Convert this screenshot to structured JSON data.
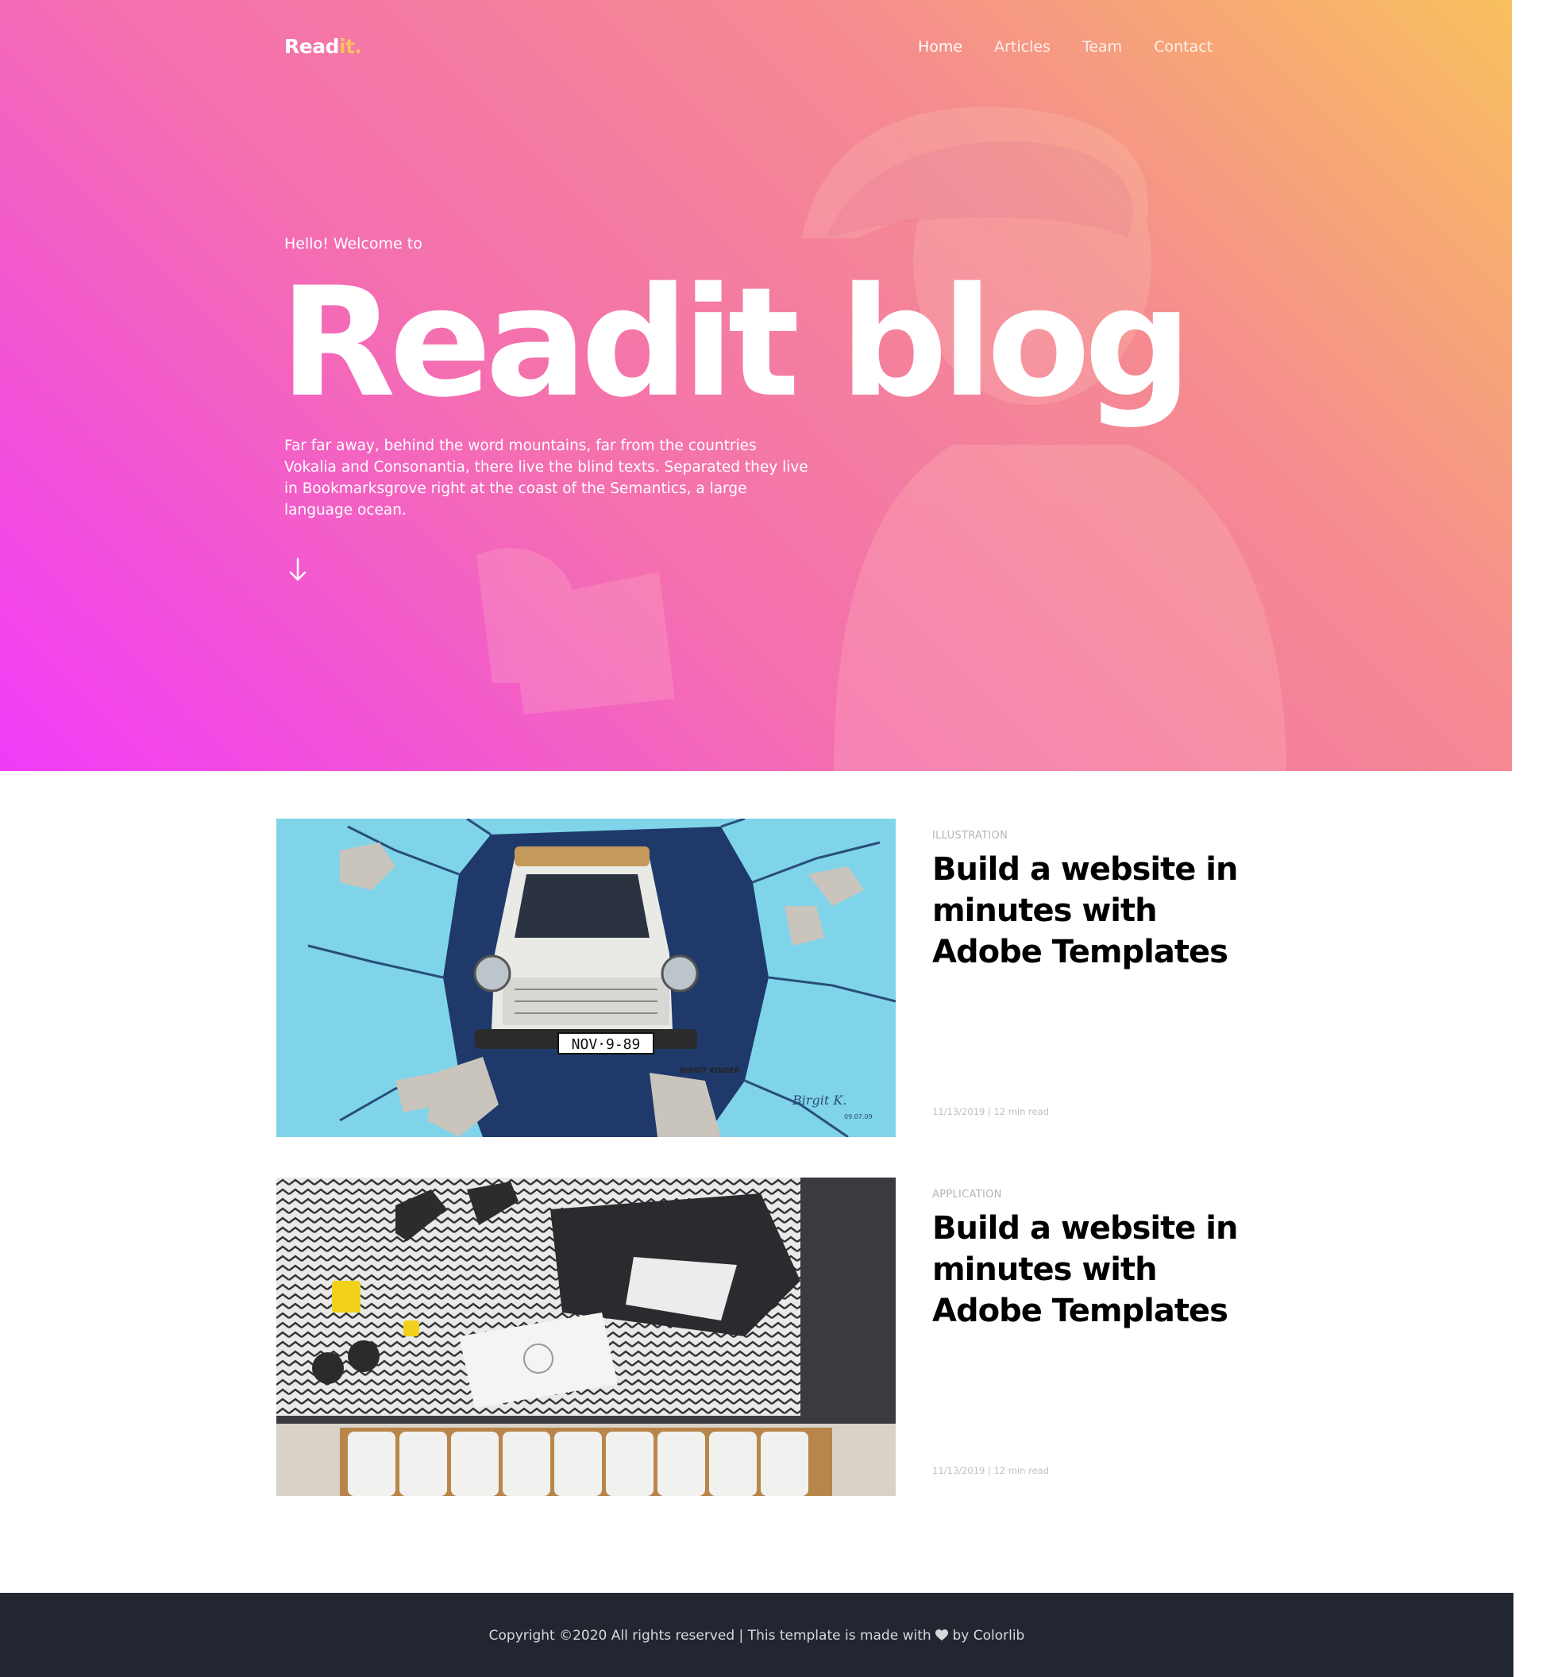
{
  "brand": {
    "name_main": "Read",
    "name_accent": "it",
    "name_dot": ".",
    "accent_color": "#f9c05e"
  },
  "nav": {
    "items": [
      {
        "label": "Home"
      },
      {
        "label": "Articles"
      },
      {
        "label": "Team"
      },
      {
        "label": "Contact"
      }
    ]
  },
  "hero": {
    "greeting": "Hello! Welcome to",
    "title": "Readit blog",
    "description": "Far far away, behind the word mountains, far from the countries Vokalia and Consonantia, there live the blind texts. Separated they live in Bookmarksgrove right at the coast of the Semantics, a large language ocean.",
    "scroll_icon": "arrow-down-icon",
    "gradient": [
      "#f9c05e",
      "#f58c8f",
      "#f46fb0",
      "#f13bf8"
    ]
  },
  "articles": [
    {
      "category": "ILLUSTRATION",
      "title": "Build a website in minutes with Adobe Templates",
      "meta": "11/13/2019 | 12 min read",
      "image": "car-through-wall-mural",
      "plate_text": "NOV·9-89",
      "mural_label": "BIRGIT KINDER",
      "signature": "Birgit K.",
      "signature_date": "09.07.09"
    },
    {
      "category": "APPLICATION",
      "title": "Build a website in minutes with Adobe Templates",
      "meta": "11/13/2019 | 12 min read",
      "image": "baby-items-flatlay"
    }
  ],
  "footer": {
    "text_before": "Copyright ©2020 All rights reserved | This template is made with",
    "heart_icon": "heart-icon",
    "text_after": "by Colorlib"
  }
}
